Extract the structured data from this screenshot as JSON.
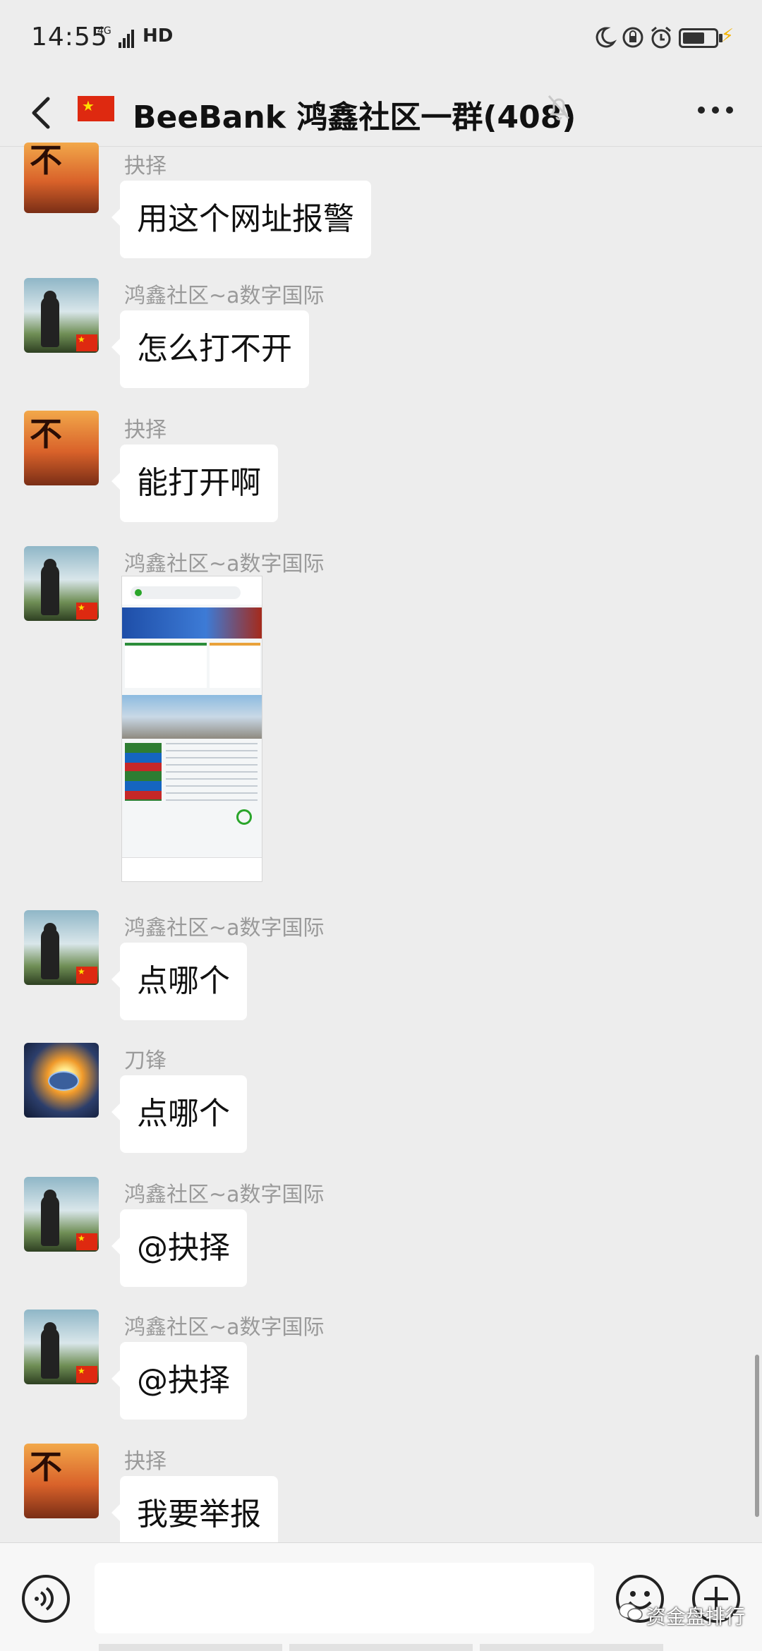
{
  "status_bar": {
    "time": "14:55",
    "network": "4G",
    "hd": "HD"
  },
  "header": {
    "title": "BeeBank 鸿鑫社区一群(408)"
  },
  "messages": [
    {
      "sender": "抉择",
      "text": "用这个网址报警",
      "avatar": "avatar-calligraphy"
    },
    {
      "sender": "鸿鑫社区~a数字国际",
      "text": "怎么打不开",
      "avatar": "avatar-silhouette-flag"
    },
    {
      "sender": "抉择",
      "text": "能打开啊",
      "avatar": "avatar-calligraphy"
    },
    {
      "sender": "鸿鑫社区~a数字国际",
      "image": "website-screenshot",
      "avatar": "avatar-silhouette-flag"
    },
    {
      "sender": "鸿鑫社区~a数字国际",
      "text": "点哪个",
      "avatar": "avatar-silhouette-flag"
    },
    {
      "sender": "刀锋",
      "text": "点哪个",
      "avatar": "avatar-steelwool"
    },
    {
      "sender": "鸿鑫社区~a数字国际",
      "text": "@抉择",
      "avatar": "avatar-silhouette-flag"
    },
    {
      "sender": "鸿鑫社区~a数字国际",
      "text": "@抉择",
      "avatar": "avatar-silhouette-flag"
    },
    {
      "sender": "抉择",
      "text": "我要举报",
      "avatar": "avatar-calligraphy"
    }
  ],
  "watermark": "资金盘排行",
  "colors": {
    "background": "#ededed",
    "bubble": "#ffffff",
    "sender": "#9a9a9a",
    "flag_red": "#de2910",
    "flag_star": "#ffde00"
  }
}
